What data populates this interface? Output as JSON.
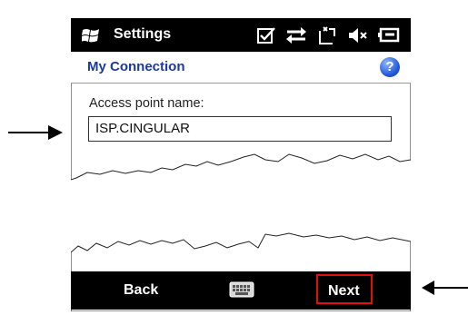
{
  "status_bar": {
    "app_title": "Settings",
    "icons": [
      "windows-logo-icon",
      "checkbox-icon",
      "data-connection-icon",
      "no-signal-icon",
      "volume-muted-icon",
      "battery-charging-icon"
    ]
  },
  "title_bar": {
    "title": "My Connection",
    "help_icon_glyph": "?"
  },
  "form": {
    "access_point_label": "Access point name:",
    "access_point_value": "ISP.CINGULAR"
  },
  "softkeys": {
    "left_label": "Back",
    "center_icon": "keyboard-icon",
    "right_label": "Next"
  },
  "colors": {
    "title_blue": "#1b3a9c",
    "highlight_red": "#e01010",
    "bar_black": "#000000"
  }
}
